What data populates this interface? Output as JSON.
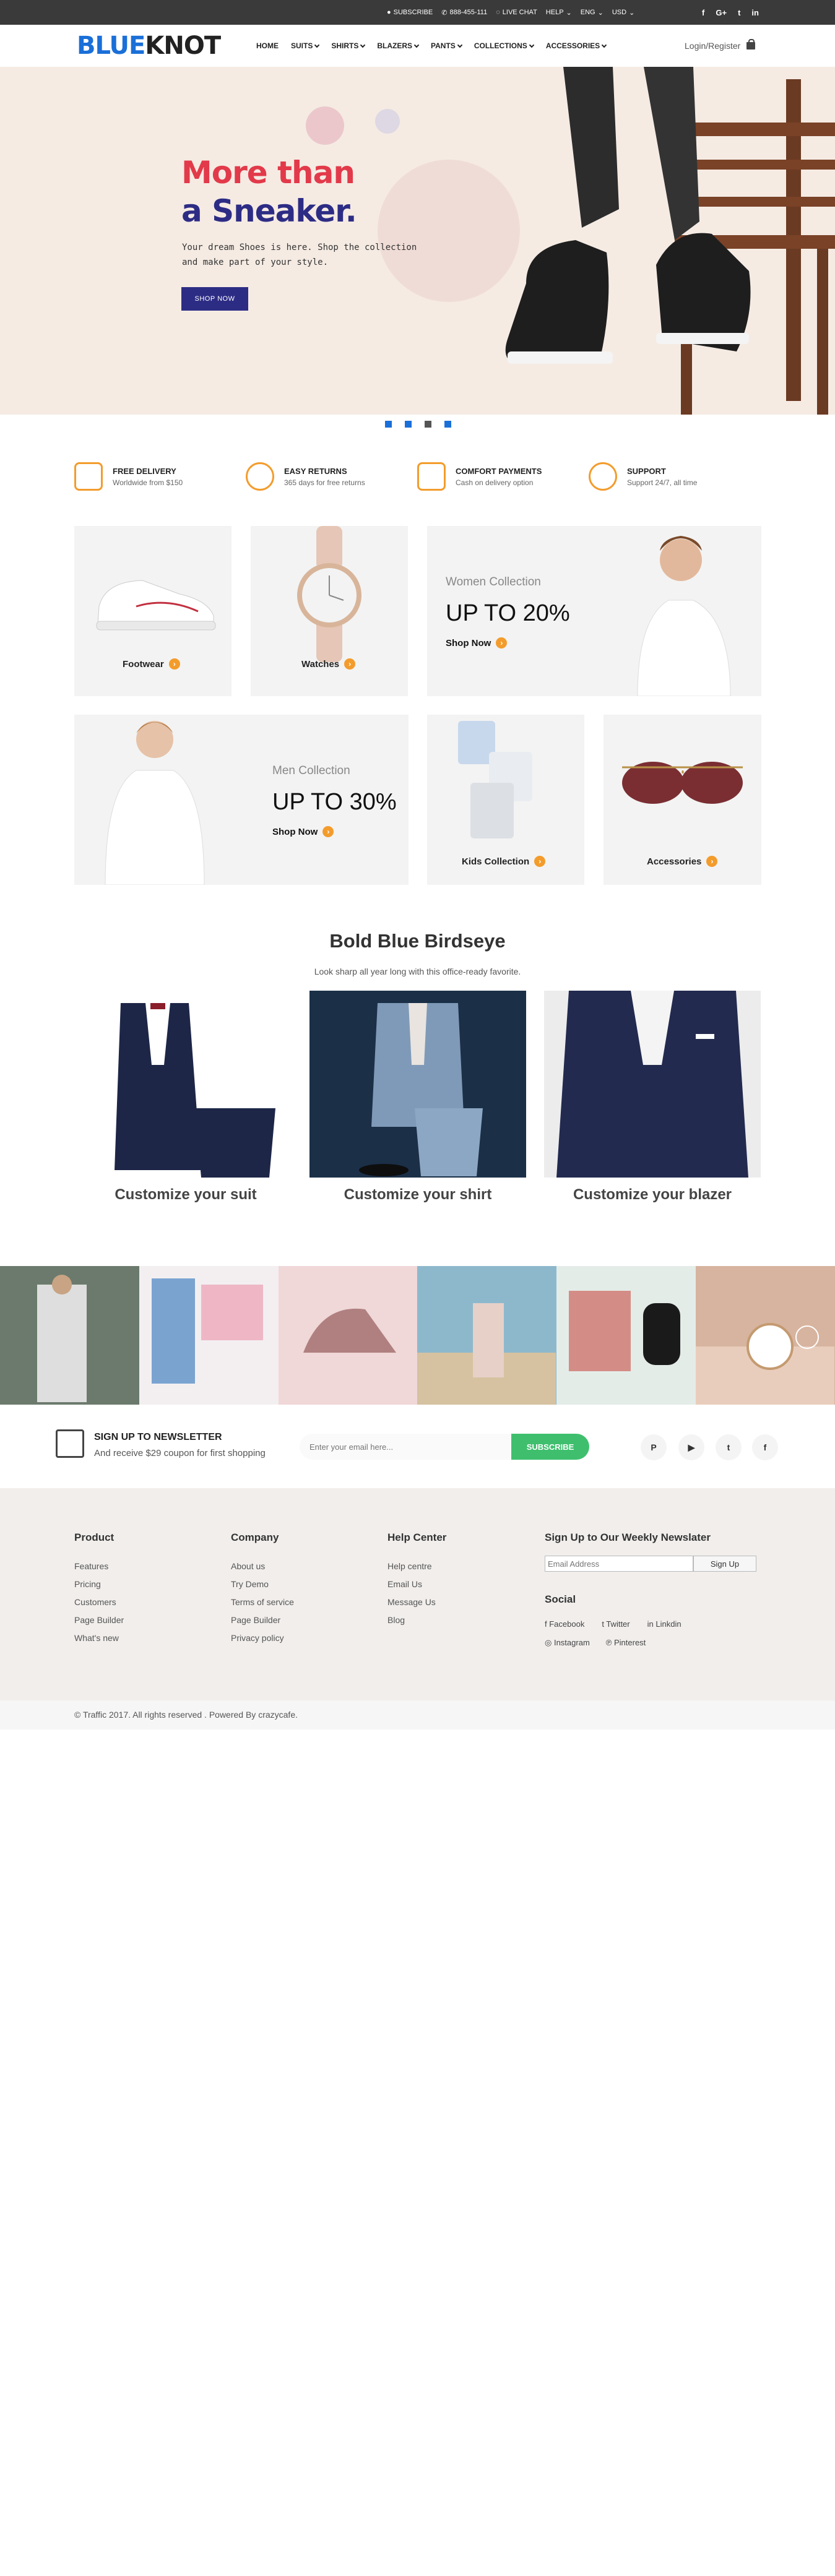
{
  "topbar": {
    "subscribe": "SUBSCRIBE",
    "phone": "888-455-111",
    "live_chat": "LIVE CHAT",
    "help": "HELP",
    "lang": "ENG",
    "currency": "USD",
    "social": [
      "f",
      "G+",
      "t",
      "in"
    ]
  },
  "header": {
    "logo_part1": "BLUE",
    "logo_part2": "KNOT",
    "nav": [
      "HOME",
      "SUITS",
      "SHIRTS",
      "BLAZERS",
      "PANTS",
      "COLLECTIONS",
      "ACCESSORIES"
    ],
    "login": "Login/Register"
  },
  "hero": {
    "title_line1": "More than",
    "title_line2": "a Sneaker.",
    "subtitle": "Your dream Shoes is here. Shop the collection and make part of your style.",
    "button": "SHOP NOW",
    "slides": 4,
    "active_slide": 3
  },
  "features": [
    {
      "title": "FREE DELIVERY",
      "desc": "Worldwide from $150",
      "icon": "truck-icon"
    },
    {
      "title": "EASY RETURNS",
      "desc": "365 days for free returns",
      "icon": "refresh-icon"
    },
    {
      "title": "COMFORT PAYMENTS",
      "desc": "Cash on delivery option",
      "icon": "wallet-icon"
    },
    {
      "title": "SUPPORT",
      "desc": "Support 24/7, all time",
      "icon": "headset-icon"
    }
  ],
  "categories": {
    "footwear": "Footwear",
    "watches": "Watches",
    "women_collection": "Women Collection",
    "women_offer": "UP TO 20%",
    "women_shop": "Shop Now",
    "men_collection": "Men Collection",
    "men_offer": "UP TO 30%",
    "men_shop": "Shop Now",
    "kids": "Kids Collection",
    "accessories": "Accessories"
  },
  "birdseye": {
    "title": "Bold Blue Birdseye",
    "subtitle": "Look sharp all year long with this office-ready favorite.",
    "cards": [
      "Customize your suit",
      "Customize your shirt",
      "Customize your blazer"
    ]
  },
  "newsletter": {
    "title": "SIGN UP TO NEWSLETTER",
    "desc": "And receive $29 coupon for first shopping",
    "placeholder": "Enter your email here...",
    "button": "SUBSCRIBE"
  },
  "footer": {
    "product": {
      "title": "Product",
      "links": [
        "Features",
        "Pricing",
        "Customers",
        "Page Builder",
        "What's new"
      ]
    },
    "company": {
      "title": "Company",
      "links": [
        "About us",
        "Try Demo",
        "Terms of service",
        "Page Builder",
        "Privacy policy"
      ]
    },
    "help": {
      "title": "Help Center",
      "links": [
        "Help centre",
        "Email Us",
        "Message Us",
        "Blog"
      ]
    },
    "signup": {
      "title": "Sign Up to Our Weekly Newslater",
      "placeholder": "Email Address",
      "button": "Sign Up"
    },
    "social": {
      "title": "Social",
      "links": [
        "Facebook",
        "Twitter",
        "Linkdin",
        "Instagram",
        "Pinterest"
      ]
    },
    "copyright": "© Traffic 2017. All rights reserved . Powered By crazycafe."
  }
}
